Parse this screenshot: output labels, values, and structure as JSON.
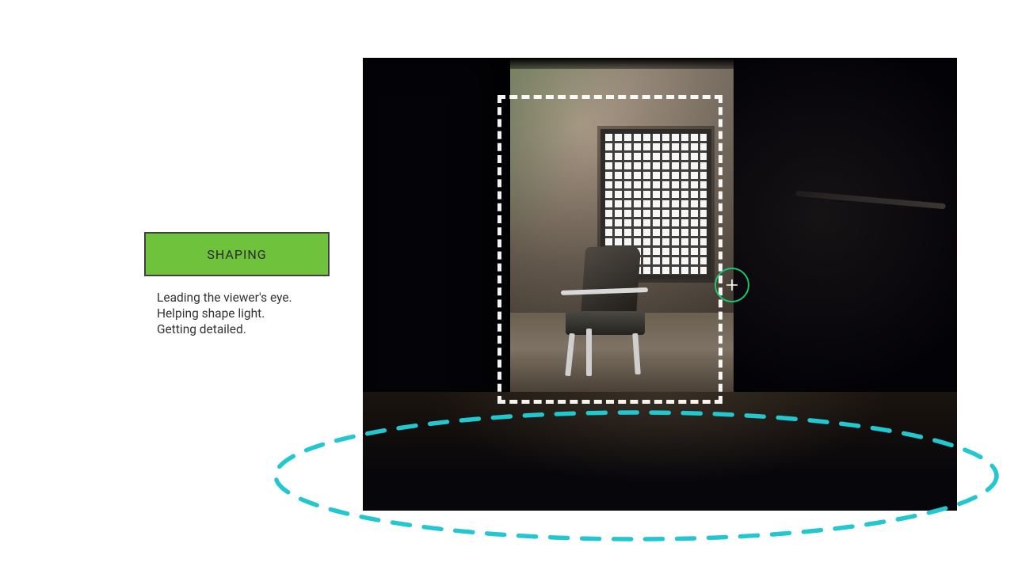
{
  "panel": {
    "title": "SHAPING",
    "line1": "Leading the viewer's eye.",
    "line2": "Helping shape light.",
    "line3": "Getting detailed."
  },
  "colors": {
    "accent_green": "#6fc23b",
    "highlight_teal": "#22c7cf",
    "cursor_ring": "#19c66d"
  }
}
